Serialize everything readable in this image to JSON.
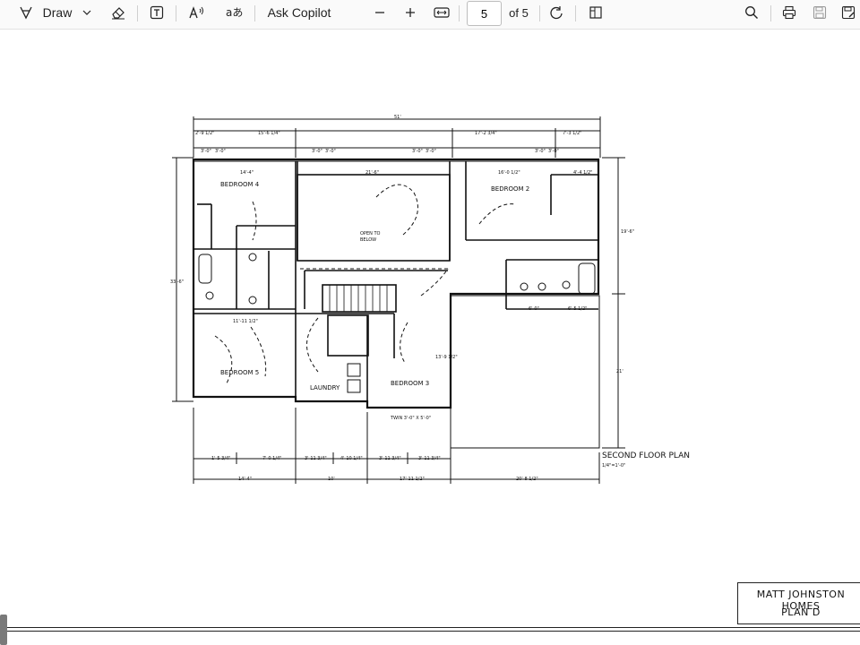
{
  "toolbar": {
    "draw_label": "Draw",
    "ask_copilot_label": "Ask Copilot",
    "page_number": "5",
    "page_total": "of 5"
  },
  "plan": {
    "overall_width": "51'",
    "top_dims": [
      "2'-9 1/2\"",
      "15'-6 1/4\"",
      "17'-2 3/4\"",
      "7'-3 1/2\""
    ],
    "top_small": [
      "3'-0\"",
      "3'-0\"",
      "3'-0\"",
      "3'-0\"",
      "3'-0\"",
      "3'-0\"",
      "3'-0\"",
      "3'-0\""
    ],
    "rooms": [
      "BEDROOM 4",
      "BEDROOM 2",
      "BEDROOM 5",
      "BEDROOM 3",
      "LAUNDRY"
    ],
    "open_to_below_1": "OPEN TO",
    "open_to_below_2": "BELOW",
    "inner_dims": [
      "14'-4\"",
      "21'-6\"",
      "16'-0 1/2\"",
      "4'-4 1/2\"",
      "11'-11 1/2\"",
      "13'-9 1/2\"",
      "6'-0\"",
      "6'-5 1/2\"",
      "TWIN 3'-0\" X 5'-0\""
    ],
    "right_dims": [
      "19'-6\"",
      "21'"
    ],
    "left_dim": "33'-6\"",
    "bottom_row1": [
      "1'-5 3/4\"",
      "7'-0 1/4\"",
      "3'-11 3/4\"",
      "4'-10 1/4\"",
      "3'-11 3/4\"",
      "3'-11 3/4\""
    ],
    "bottom_row2": [
      "14'-4\"",
      "10'",
      "17'-11 1/2\"",
      "20'-8 1/2\""
    ],
    "caption": "SECOND FLOOR PLAN",
    "scale": "1/4\"=1'-0\""
  },
  "title_block": {
    "company": "MATT JOHNSTON HOMES",
    "plan": "PLAN D"
  }
}
